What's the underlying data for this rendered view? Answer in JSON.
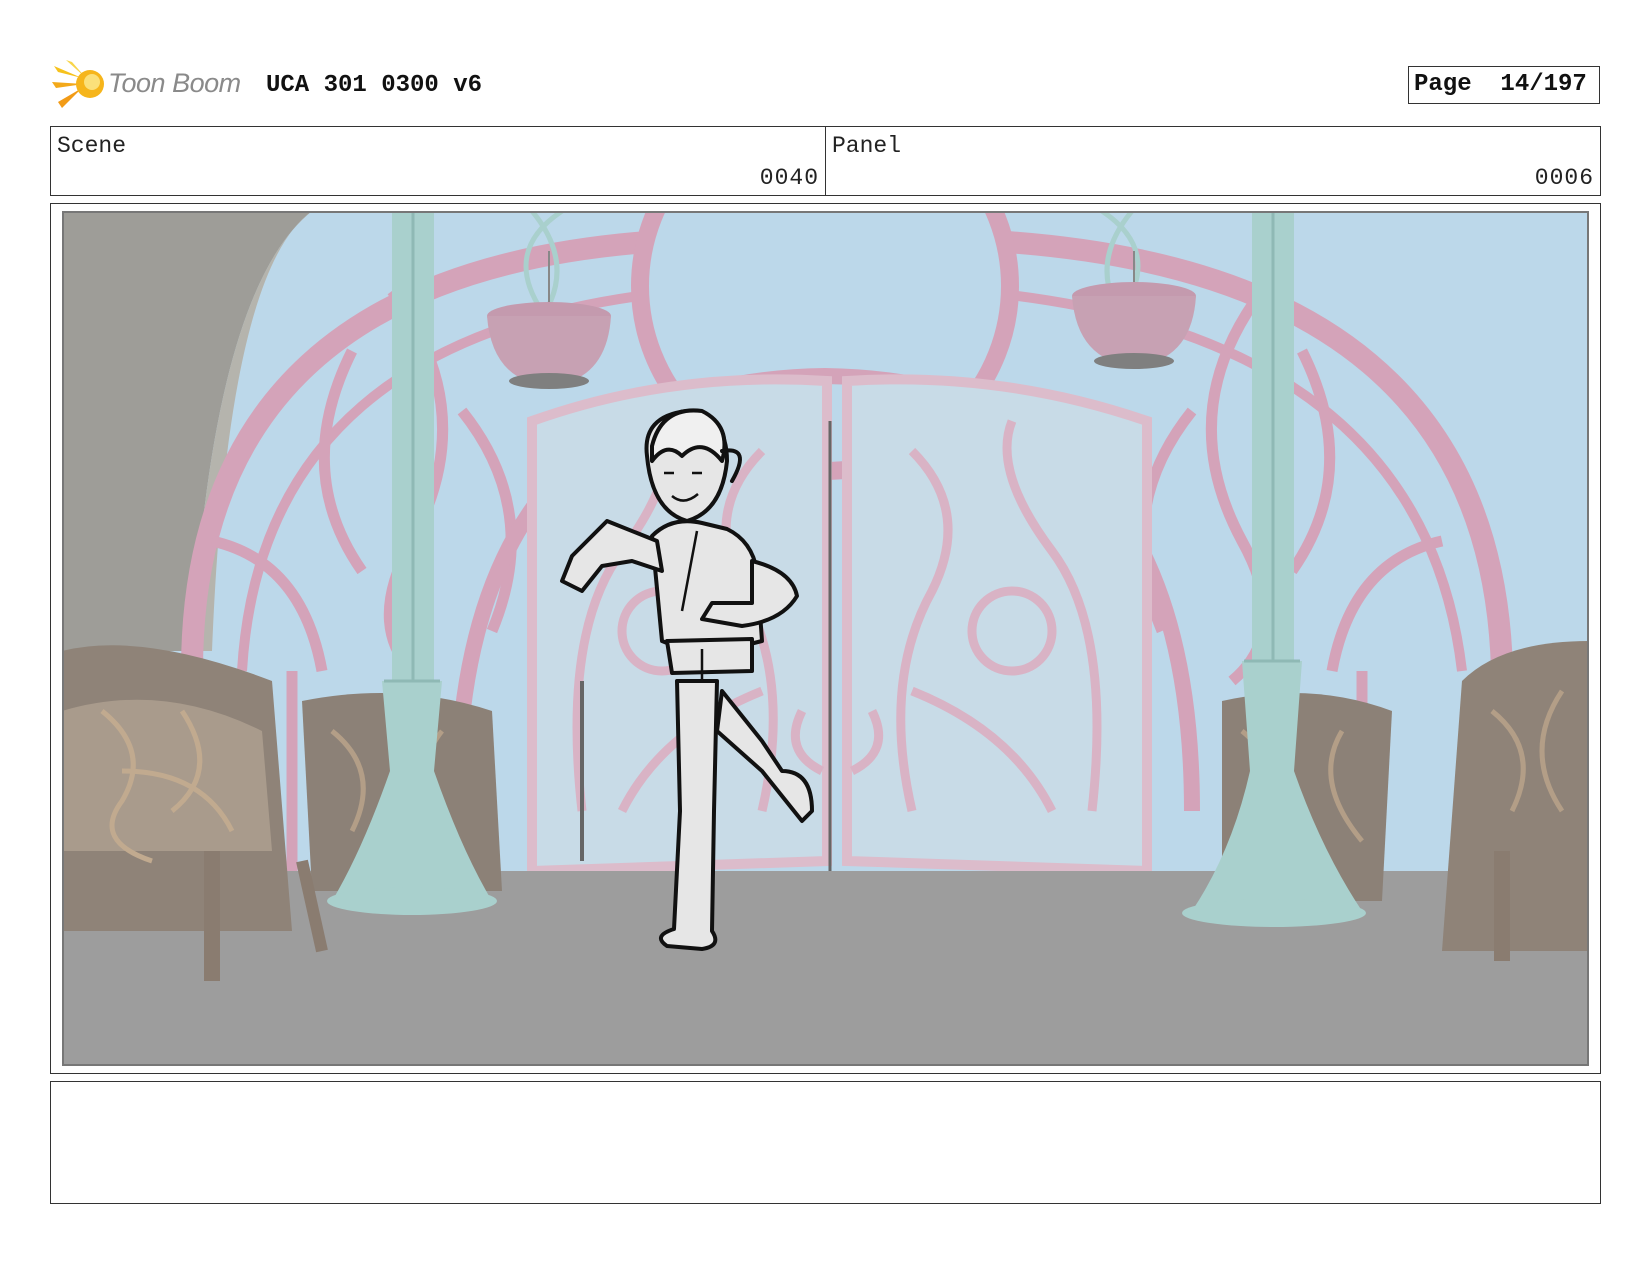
{
  "header": {
    "logo_text": "Toon Boom",
    "title": "UCA 301 0300 v6",
    "page_label": "Page",
    "page_number": "14/197"
  },
  "info": {
    "scene_label": "Scene",
    "scene_value": "0040",
    "panel_label": "Panel",
    "panel_value": "0006"
  },
  "notes": {
    "text": ""
  },
  "colors": {
    "sky": "#bcd8ea",
    "ironwork": "#d4a3b9",
    "pillar": "#a9d0cd",
    "floor": "#9d9d9d",
    "chair": "#8f8378",
    "logo_accent": "#f3b81a"
  }
}
